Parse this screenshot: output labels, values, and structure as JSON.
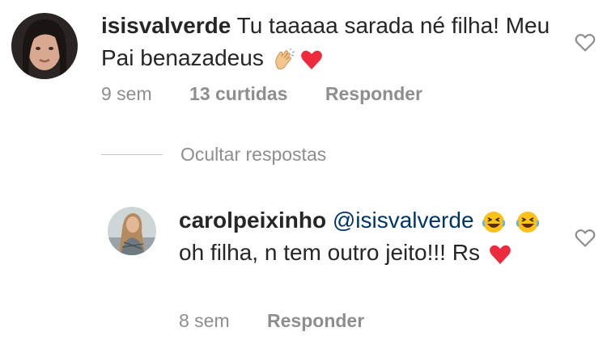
{
  "comment": {
    "username": "isisvalverde",
    "text": "Tu taaaaa sarada né filha! Meu Pai benazadeus",
    "time": "9 sem",
    "likes": "13 curtidas",
    "reply_label": "Responder"
  },
  "replies_toggle": {
    "label": "Ocultar respostas"
  },
  "reply": {
    "username": "carolpeixinho",
    "mention": "@isisvalverde",
    "text": "oh filha, n tem outro jeito!!! Rs",
    "time": "8 sem",
    "reply_label": "Responder"
  },
  "icons": [
    "heart-outline-icon",
    "clapping-hands-emoji",
    "red-heart-emoji",
    "rolling-laughing-emoji"
  ],
  "colors": {
    "text": "#262626",
    "meta": "#8e8e8e",
    "mention": "#003569",
    "heart": "#ed2b3f"
  }
}
